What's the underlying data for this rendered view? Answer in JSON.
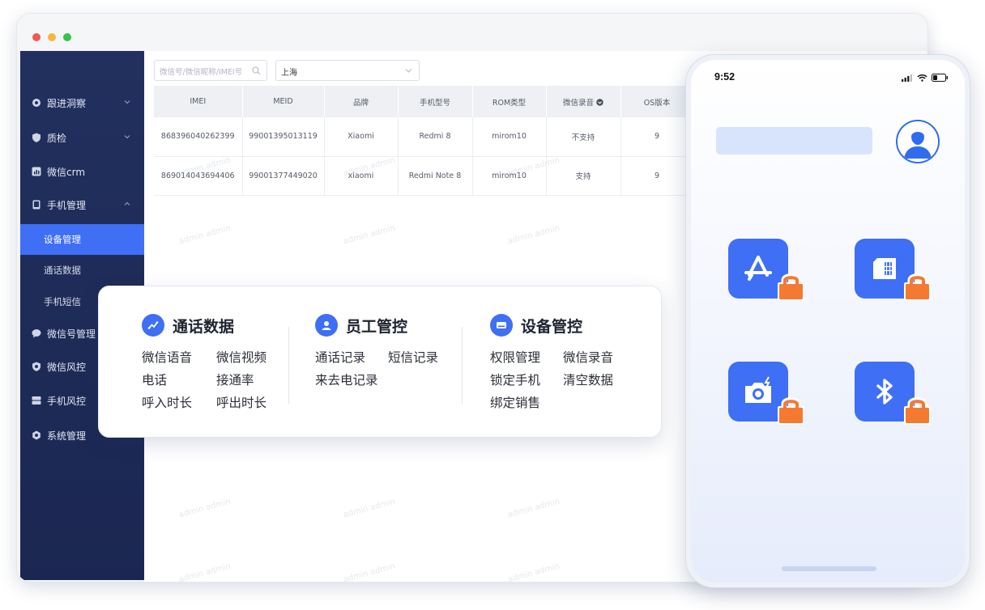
{
  "sidebar": {
    "items": [
      {
        "label": "跟进洞察",
        "icon": "eye-icon"
      },
      {
        "label": "质检",
        "icon": "shield-check-icon"
      },
      {
        "label": "微信crm",
        "icon": "chart-icon"
      },
      {
        "label": "手机管理",
        "icon": "phone-icon"
      },
      {
        "label": "微信号管理",
        "icon": "chat-icon"
      },
      {
        "label": "微信风控",
        "icon": "shield-icon"
      },
      {
        "label": "手机风控",
        "icon": "server-icon"
      },
      {
        "label": "系统管理",
        "icon": "gear-icon"
      }
    ],
    "subitems": [
      {
        "label": "设备管理",
        "active": true
      },
      {
        "label": "通话数据",
        "active": false
      },
      {
        "label": "手机短信",
        "active": false
      }
    ]
  },
  "filters": {
    "search_placeholder": "微信号/微信昵称/IMEI号",
    "region_value": "上海"
  },
  "table": {
    "headers": [
      "IMEI",
      "MEID",
      "品牌",
      "手机型号",
      "ROM类型",
      "微信录音",
      "OS版本"
    ],
    "rows": [
      [
        "868396040262399",
        "99001395013119",
        "Xiaomi",
        "Redmi 8",
        "mirom10",
        "不支持",
        "9"
      ],
      [
        "869014043694406",
        "99001377449020",
        "xiaomi",
        "Redmi Note 8",
        "mirom10",
        "支持",
        "9"
      ]
    ]
  },
  "watermark": "admin admin",
  "features": {
    "call_data": {
      "title": "通话数据",
      "items": [
        "微信语音",
        "微信视频",
        "电话",
        "接通率",
        "呼入时长",
        "呼出时长"
      ]
    },
    "staff": {
      "title": "员工管控",
      "items": [
        "通话记录",
        "短信记录",
        "来去电记录"
      ]
    },
    "device": {
      "title": "设备管控",
      "items": [
        "权限管理",
        "微信录音",
        "锁定手机",
        "清空数据",
        "绑定销售"
      ]
    }
  },
  "phone": {
    "time": "9:52",
    "apps": [
      "app-store-icon",
      "sim-card-icon",
      "camera-icon",
      "bluetooth-icon"
    ]
  },
  "colors": {
    "accent": "#3e6ff5",
    "sidebar": "#1f2c59",
    "lock": "#f47a32"
  }
}
